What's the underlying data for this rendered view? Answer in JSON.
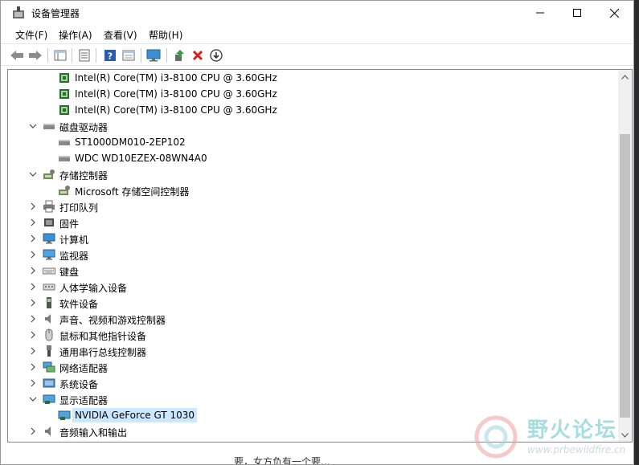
{
  "window": {
    "title": "设备管理器"
  },
  "menu": [
    "文件(F)",
    "操作(A)",
    "查看(V)",
    "帮助(H)"
  ],
  "toolbar": {
    "icons": [
      "back-arrow-icon",
      "forward-arrow-icon",
      "show-hide-tree-icon",
      "properties-icon",
      "help-icon",
      "view-icon",
      "monitor-scan-icon",
      "update-driver-icon",
      "uninstall-icon",
      "disable-device-icon"
    ]
  },
  "tree": [
    {
      "level": 2,
      "expander": "",
      "icon": "cpu",
      "label": "Intel(R) Core(TM) i3-8100 CPU @ 3.60GHz"
    },
    {
      "level": 2,
      "expander": "",
      "icon": "cpu",
      "label": "Intel(R) Core(TM) i3-8100 CPU @ 3.60GHz"
    },
    {
      "level": 2,
      "expander": "",
      "icon": "cpu",
      "label": "Intel(R) Core(TM) i3-8100 CPU @ 3.60GHz"
    },
    {
      "level": 1,
      "expander": "down",
      "icon": "disk",
      "label": "磁盘驱动器"
    },
    {
      "level": 2,
      "expander": "",
      "icon": "disk",
      "label": "ST1000DM010-2EP102"
    },
    {
      "level": 2,
      "expander": "",
      "icon": "disk",
      "label": "WDC WD10EZEX-08WN4A0"
    },
    {
      "level": 1,
      "expander": "down",
      "icon": "storage",
      "label": "存储控制器"
    },
    {
      "level": 2,
      "expander": "",
      "icon": "storage",
      "label": "Microsoft 存储空间控制器"
    },
    {
      "level": 1,
      "expander": "right",
      "icon": "printer",
      "label": "打印队列"
    },
    {
      "level": 1,
      "expander": "right",
      "icon": "firmware",
      "label": "固件"
    },
    {
      "level": 1,
      "expander": "right",
      "icon": "computer",
      "label": "计算机"
    },
    {
      "level": 1,
      "expander": "right",
      "icon": "monitor",
      "label": "监视器"
    },
    {
      "level": 1,
      "expander": "right",
      "icon": "keyboard",
      "label": "键盘"
    },
    {
      "level": 1,
      "expander": "right",
      "icon": "hid",
      "label": "人体学输入设备"
    },
    {
      "level": 1,
      "expander": "right",
      "icon": "software",
      "label": "软件设备"
    },
    {
      "level": 1,
      "expander": "right",
      "icon": "audio",
      "label": "声音、视频和游戏控制器"
    },
    {
      "level": 1,
      "expander": "right",
      "icon": "mouse",
      "label": "鼠标和其他指针设备"
    },
    {
      "level": 1,
      "expander": "right",
      "icon": "usb",
      "label": "通用串行总线控制器"
    },
    {
      "level": 1,
      "expander": "right",
      "icon": "network",
      "label": "网络适配器"
    },
    {
      "level": 1,
      "expander": "right",
      "icon": "system",
      "label": "系统设备"
    },
    {
      "level": 1,
      "expander": "down",
      "icon": "display",
      "label": "显示适配器"
    },
    {
      "level": 2,
      "expander": "",
      "icon": "display",
      "label": "NVIDIA GeForce GT 1030",
      "selected": true
    },
    {
      "level": 1,
      "expander": "right",
      "icon": "audio",
      "label": "音频输入和输出"
    }
  ],
  "watermark": {
    "text": "野火论坛",
    "url": "www.prbewildfire.cn"
  },
  "background_text": "要，女方负有一个要..."
}
